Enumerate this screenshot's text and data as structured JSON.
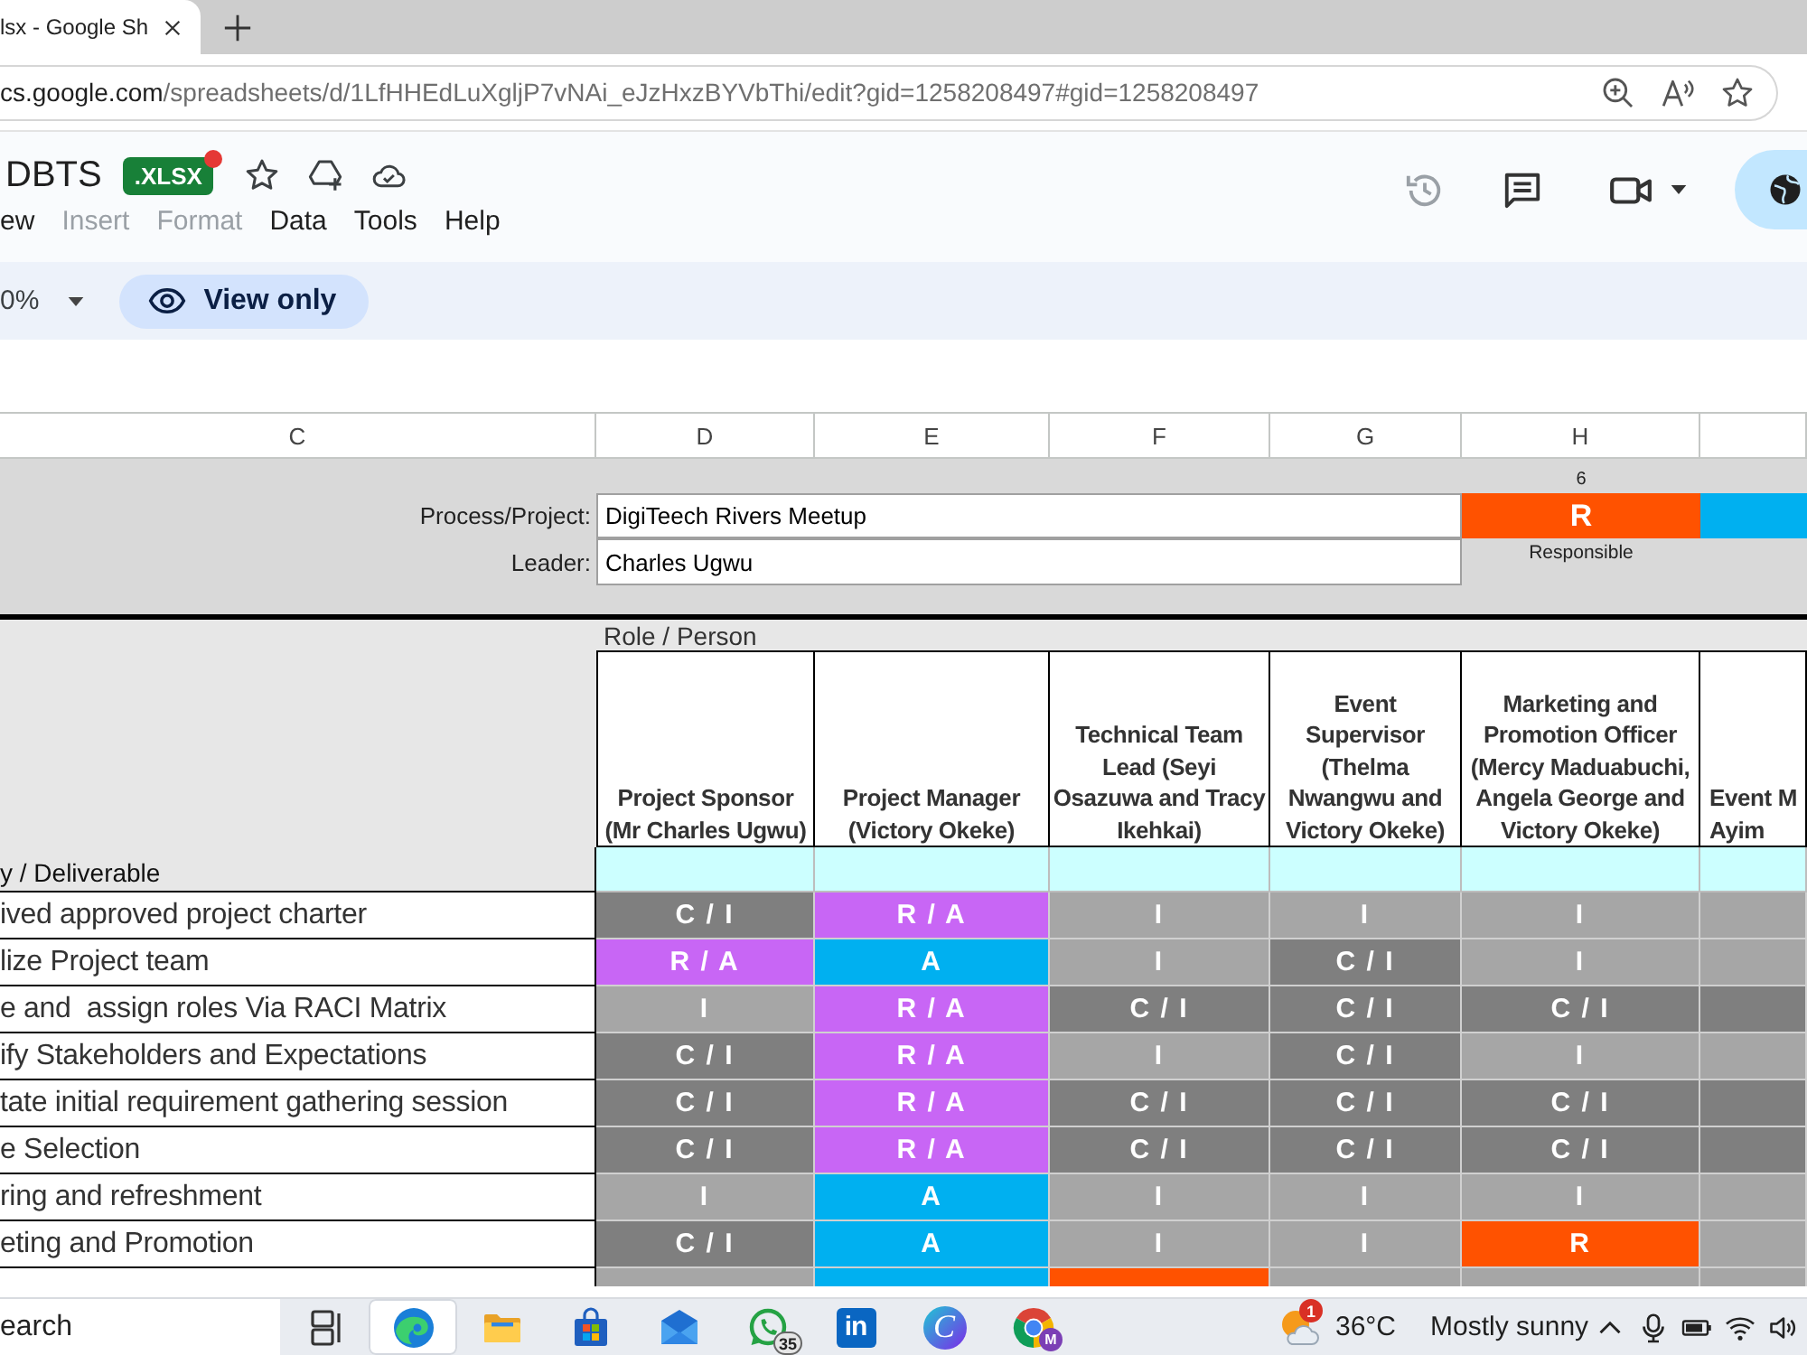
{
  "browser": {
    "tabs": [
      {
        "title": "lsx - Google Sh",
        "selected": true
      }
    ],
    "address": {
      "host": "cs.google.com",
      "path": "/spreadsheets/d/1LfHHEdLuXgljP7vNAi_eJzHxzBYVbThi/edit?gid=1258208497#gid=1258208497"
    }
  },
  "document": {
    "title": "DBTS",
    "format": ".XLSX"
  },
  "menu": [
    {
      "label": "ew",
      "disabled": false
    },
    {
      "label": "Insert",
      "disabled": true
    },
    {
      "label": "Format",
      "disabled": true
    },
    {
      "label": "Data",
      "disabled": false
    },
    {
      "label": "Tools",
      "disabled": false
    },
    {
      "label": "Help",
      "disabled": false
    }
  ],
  "toolbar": {
    "zoom": "0%",
    "mode": "View only"
  },
  "sheet": {
    "columns": [
      "C",
      "D",
      "E",
      "F",
      "G",
      "H"
    ]
  },
  "info": {
    "fields": [
      {
        "label": "Process/Project:",
        "value": "DigiTeech Rivers Meetup"
      },
      {
        "label": "Leader:",
        "value": "Charles Ugwu"
      }
    ],
    "legend": [
      {
        "count": "6",
        "letter": "R",
        "caption": "Responsible",
        "color": "#ff5200"
      },
      {
        "color": "#00b0f0"
      }
    ]
  },
  "matrix": {
    "role_label": "Role / Person",
    "activity_label": "y / Deliverable",
    "roles": [
      "Project Sponsor (Mr Charles Ugwu)",
      "Project Manager (Victory Okeke)",
      "Technical Team Lead (Seyi Osazuwa and Tracy Ikehkai)",
      "Event Supervisor (Thelma Nwangwu and Victory Okeke)",
      "Marketing and Promotion Officer (Mercy Maduabuchi, Angela George and Victory Okeke)",
      "Event M\nAyim"
    ],
    "rows": [
      {
        "activity": "ived approved project charter",
        "cells": [
          {
            "value": "C / I",
            "color": "#7f7f7f"
          },
          {
            "value": "R / A",
            "color": "#c866f5"
          },
          {
            "value": "I",
            "color": "#a6a6a6"
          },
          {
            "value": "I",
            "color": "#a6a6a6"
          },
          {
            "value": "I",
            "color": "#a6a6a6"
          },
          {
            "color": "#a6a6a6"
          }
        ]
      },
      {
        "activity": "lize Project team",
        "cells": [
          {
            "value": "R / A",
            "color": "#c866f5"
          },
          {
            "value": "A",
            "color": "#00b0f0"
          },
          {
            "value": "I",
            "color": "#a6a6a6"
          },
          {
            "value": "C / I",
            "color": "#7f7f7f"
          },
          {
            "value": "I",
            "color": "#a6a6a6"
          },
          {
            "color": "#a6a6a6"
          }
        ]
      },
      {
        "activity": "e and  assign roles Via RACI Matrix",
        "cells": [
          {
            "value": "I",
            "color": "#a6a6a6"
          },
          {
            "value": "R / A",
            "color": "#c866f5"
          },
          {
            "value": "C / I",
            "color": "#7f7f7f"
          },
          {
            "value": "C / I",
            "color": "#7f7f7f"
          },
          {
            "value": "C / I",
            "color": "#7f7f7f"
          },
          {
            "color": "#7f7f7f"
          }
        ]
      },
      {
        "activity": "ify Stakeholders and Expectations",
        "cells": [
          {
            "value": "C / I",
            "color": "#7f7f7f"
          },
          {
            "value": "R / A",
            "color": "#c866f5"
          },
          {
            "value": "I",
            "color": "#a6a6a6"
          },
          {
            "value": "C / I",
            "color": "#7f7f7f"
          },
          {
            "value": "I",
            "color": "#a6a6a6"
          },
          {
            "color": "#a6a6a6"
          }
        ]
      },
      {
        "activity": "tate initial requirement gathering session",
        "cells": [
          {
            "value": "C / I",
            "color": "#7f7f7f"
          },
          {
            "value": "R / A",
            "color": "#c866f5"
          },
          {
            "value": "C / I",
            "color": "#7f7f7f"
          },
          {
            "value": "C / I",
            "color": "#7f7f7f"
          },
          {
            "value": "C / I",
            "color": "#7f7f7f"
          },
          {
            "color": "#7f7f7f"
          }
        ]
      },
      {
        "activity": "e Selection",
        "cells": [
          {
            "value": "C / I",
            "color": "#7f7f7f"
          },
          {
            "value": "R / A",
            "color": "#c866f5"
          },
          {
            "value": "C / I",
            "color": "#7f7f7f"
          },
          {
            "value": "C / I",
            "color": "#7f7f7f"
          },
          {
            "value": "C / I",
            "color": "#7f7f7f"
          },
          {
            "color": "#7f7f7f"
          }
        ]
      },
      {
        "activity": "ring and refreshment",
        "cells": [
          {
            "value": "I",
            "color": "#a6a6a6"
          },
          {
            "value": "A",
            "color": "#00b0f0"
          },
          {
            "value": "I",
            "color": "#a6a6a6"
          },
          {
            "value": "I",
            "color": "#a6a6a6"
          },
          {
            "value": "I",
            "color": "#a6a6a6"
          },
          {
            "color": "#a6a6a6"
          }
        ]
      },
      {
        "activity": "eting and Promotion",
        "cells": [
          {
            "value": "C / I",
            "color": "#7f7f7f"
          },
          {
            "value": "A",
            "color": "#00b0f0"
          },
          {
            "value": "I",
            "color": "#a6a6a6"
          },
          {
            "value": "I",
            "color": "#a6a6a6"
          },
          {
            "value": "R",
            "color": "#ff5200"
          },
          {
            "color": "#a6a6a6"
          }
        ]
      },
      {
        "cells": [
          {
            "color": "#a6a6a6"
          },
          {
            "color": "#00b0f0"
          },
          {
            "color": "#ff5200"
          },
          {
            "color": "#a6a6a6"
          },
          {
            "color": "#a6a6a6"
          },
          {
            "color": "#a6a6a6"
          }
        ]
      }
    ]
  },
  "taskbar": {
    "search": {
      "placeholder": "earch"
    },
    "apps": [
      {
        "kind": "taskview",
        "selected": false
      },
      {
        "kind": "browser",
        "selected": true
      },
      {
        "kind": "folder",
        "selected": false
      },
      {
        "kind": "store",
        "selected": false
      },
      {
        "kind": "mail",
        "selected": false
      },
      {
        "kind": "chat",
        "badge": "35",
        "selected": false
      },
      {
        "kind": "tile",
        "glyph": "in",
        "selected": false
      },
      {
        "kind": "disc",
        "glyph": "C",
        "selected": false
      },
      {
        "kind": "ring",
        "badge": "M",
        "selected": false
      }
    ],
    "weather": {
      "badge": "1",
      "temperature": "36°C",
      "condition": "Mostly sunny"
    },
    "tray": [
      {
        "kind": "chevron"
      },
      {
        "kind": "microphone"
      },
      {
        "kind": "battery"
      },
      {
        "kind": "wifi"
      },
      {
        "kind": "volume"
      }
    ]
  }
}
